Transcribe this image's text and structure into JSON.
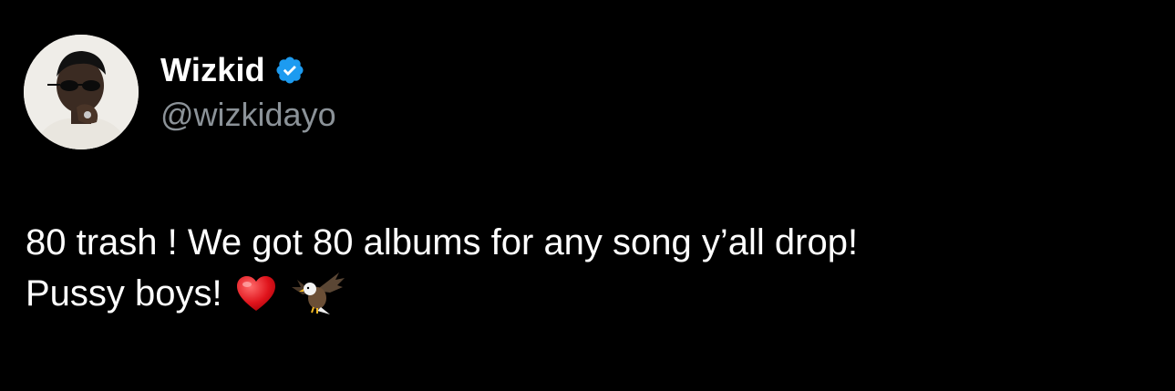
{
  "tweet": {
    "author": {
      "display_name": "Wizkid",
      "handle": "@wizkidayo",
      "verified": true,
      "verified_badge_color": "#1d9bf0",
      "avatar_icon": "profile-avatar"
    },
    "text_line_1": "80 trash ! We got 80 albums for any song y’all drop!",
    "text_line_2": "Pussy boys!",
    "emojis": [
      "red-heart-icon",
      "eagle-icon"
    ],
    "colors": {
      "background": "#000000",
      "name": "#ffffff",
      "handle": "#8b9298",
      "text": "#ffffff"
    }
  }
}
